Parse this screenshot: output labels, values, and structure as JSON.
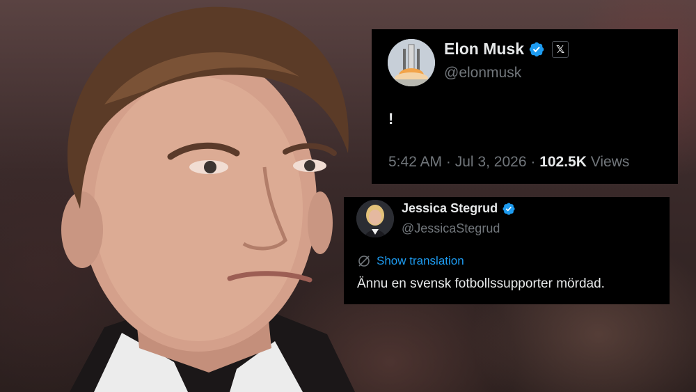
{
  "colors": {
    "card_bg": "#000000",
    "text_primary": "#e7e9ea",
    "text_secondary": "#71767b",
    "accent_blue": "#1d9bf0"
  },
  "tweet_main": {
    "display_name": "Elon Musk",
    "handle": "@elonmusk",
    "verified_icon": "verified-badge-icon",
    "affiliation_icon": "x-logo-icon",
    "affiliation_text": "𝕏",
    "text": "!",
    "time": "5:42 AM",
    "date": "Jul 3, 2026",
    "separator": "·",
    "views_count": "102.5K",
    "views_label": "Views"
  },
  "tweet_reply": {
    "display_name": "Jessica Stegrud",
    "handle": "@JessicaStegrud",
    "verified_icon": "verified-badge-icon",
    "translation_icon": "translate-icon",
    "translation_label": "Show translation",
    "text": "Ännu en svensk fotbollssupporter mördad."
  }
}
